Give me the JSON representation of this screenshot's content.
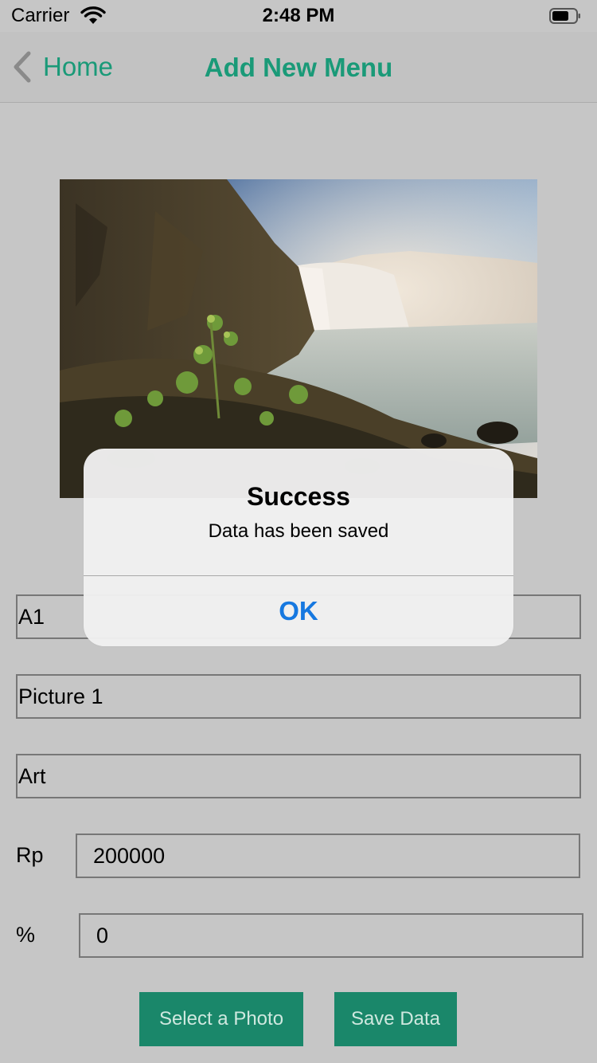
{
  "status_bar": {
    "carrier": "Carrier",
    "time": "2:48 PM",
    "wifi_icon": "wifi-icon",
    "battery_icon": "battery-icon"
  },
  "nav": {
    "back_label": "Home",
    "back_icon": "chevron-left-icon",
    "title": "Add New Menu",
    "accent_color": "#1a9a78"
  },
  "photo": {
    "subject": "waterfall-landscape-photo"
  },
  "form": {
    "code_value": "A1",
    "name_value": "Picture 1",
    "category_value": "Art",
    "price_prefix": "Rp",
    "price_value": "200000",
    "discount_prefix": "%",
    "discount_value": "0"
  },
  "buttons": {
    "select_photo": "Select a Photo",
    "save_data": "Save Data",
    "button_color": "#1a876a"
  },
  "alert": {
    "title": "Success",
    "message": "Data has been saved",
    "ok_label": "OK",
    "ok_color": "#1678e0"
  }
}
